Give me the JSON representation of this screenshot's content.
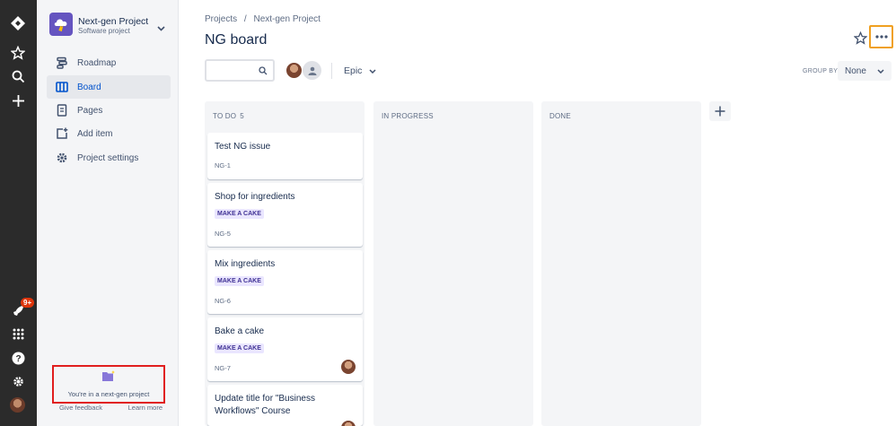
{
  "colors": {
    "accent": "#0052CC",
    "rail": "#2b2b2b",
    "epic_bg": "#EAE6FF",
    "epic_text": "#403294",
    "highlight_box": "#E01E1E",
    "highlight_more": "#F0A020"
  },
  "rail": {
    "icons": [
      "jira-logo-icon",
      "star-icon",
      "search-icon",
      "plus-icon",
      "rocket-icon",
      "apps-grid-icon",
      "help-icon",
      "gear-icon"
    ],
    "notification_badge": "9+"
  },
  "project": {
    "name": "Next-gen Project",
    "type": "Software project"
  },
  "sidebar": {
    "items": [
      {
        "label": "Roadmap",
        "icon": "roadmap-icon"
      },
      {
        "label": "Board",
        "icon": "board-icon",
        "active": true
      },
      {
        "label": "Pages",
        "icon": "pages-icon"
      },
      {
        "label": "Add item",
        "icon": "add-item-icon"
      },
      {
        "label": "Project settings",
        "icon": "gear-icon"
      }
    ],
    "nextgen_text": "You're in a next-gen project",
    "feedback_label": "Give feedback",
    "learn_label": "Learn more"
  },
  "breadcrumb": {
    "root": "Projects",
    "separator": "/",
    "current": "Next-gen Project"
  },
  "page_title": "NG board",
  "toolbar": {
    "epic_label": "Epic",
    "groupby_label": "GROUP BY",
    "groupby_value": "None"
  },
  "columns": [
    {
      "name": "TO DO",
      "count": "5"
    },
    {
      "name": "IN PROGRESS",
      "count": ""
    },
    {
      "name": "DONE",
      "count": ""
    }
  ],
  "cards": [
    {
      "title": "Test NG issue",
      "key": "NG-1",
      "epic": ""
    },
    {
      "title": "Shop for ingredients",
      "key": "NG-5",
      "epic": "MAKE A CAKE"
    },
    {
      "title": "Mix ingredients",
      "key": "NG-6",
      "epic": "MAKE A CAKE"
    },
    {
      "title": "Bake a cake",
      "key": "NG-7",
      "epic": "MAKE A CAKE",
      "assigned": true
    },
    {
      "title": "Update title for \"Business Workflows\" Course",
      "key": "",
      "epic": ""
    }
  ]
}
